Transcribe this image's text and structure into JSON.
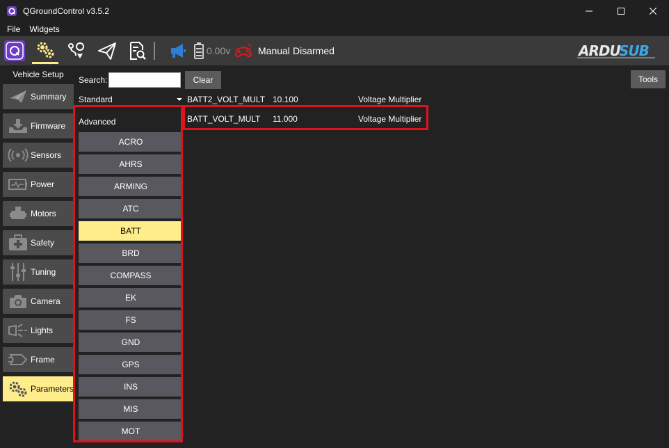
{
  "window": {
    "title": "QGroundControl v3.5.2"
  },
  "menu": {
    "file": "File",
    "widgets": "Widgets"
  },
  "toolbar": {
    "voltage": "0.00v",
    "mode": "Manual",
    "arm_state": "Disarmed",
    "brand": "ARDUSUB"
  },
  "nav": {
    "title": "Vehicle Setup",
    "items": [
      {
        "label": "Summary",
        "icon": "paper-plane-icon"
      },
      {
        "label": "Firmware",
        "icon": "download-icon"
      },
      {
        "label": "Sensors",
        "icon": "radio-waves-icon"
      },
      {
        "label": "Power",
        "icon": "battery-pulse-icon"
      },
      {
        "label": "Motors",
        "icon": "motor-icon"
      },
      {
        "label": "Safety",
        "icon": "first-aid-icon"
      },
      {
        "label": "Tuning",
        "icon": "sliders-icon"
      },
      {
        "label": "Camera",
        "icon": "camera-icon"
      },
      {
        "label": "Lights",
        "icon": "light-icon"
      },
      {
        "label": "Frame",
        "icon": "frame-icon"
      },
      {
        "label": "Parameters",
        "icon": "gears-icon",
        "selected": true
      }
    ]
  },
  "search": {
    "label": "Search:",
    "value": "",
    "clear_label": "Clear"
  },
  "tools_label": "Tools",
  "groups": {
    "combo_value": "Standard",
    "advanced_label": "Advanced",
    "items": [
      "ACRO",
      "AHRS",
      "ARMING",
      "ATC",
      "BATT",
      "BRD",
      "COMPASS",
      "EK",
      "FS",
      "GND",
      "GPS",
      "INS",
      "MIS",
      "MOT"
    ],
    "selected": "BATT"
  },
  "params": [
    {
      "name": "BATT2_VOLT_MULT",
      "value": "10.100",
      "desc": "Voltage Multiplier"
    },
    {
      "name": "BATT_VOLT_MULT",
      "value": "11.000",
      "desc": "Voltage Multiplier"
    }
  ],
  "colors": {
    "highlight": "#ffec8b",
    "annotation_red": "#e0131d",
    "toolbar_bg": "#3a3a3a",
    "window_bg": "#222222"
  }
}
